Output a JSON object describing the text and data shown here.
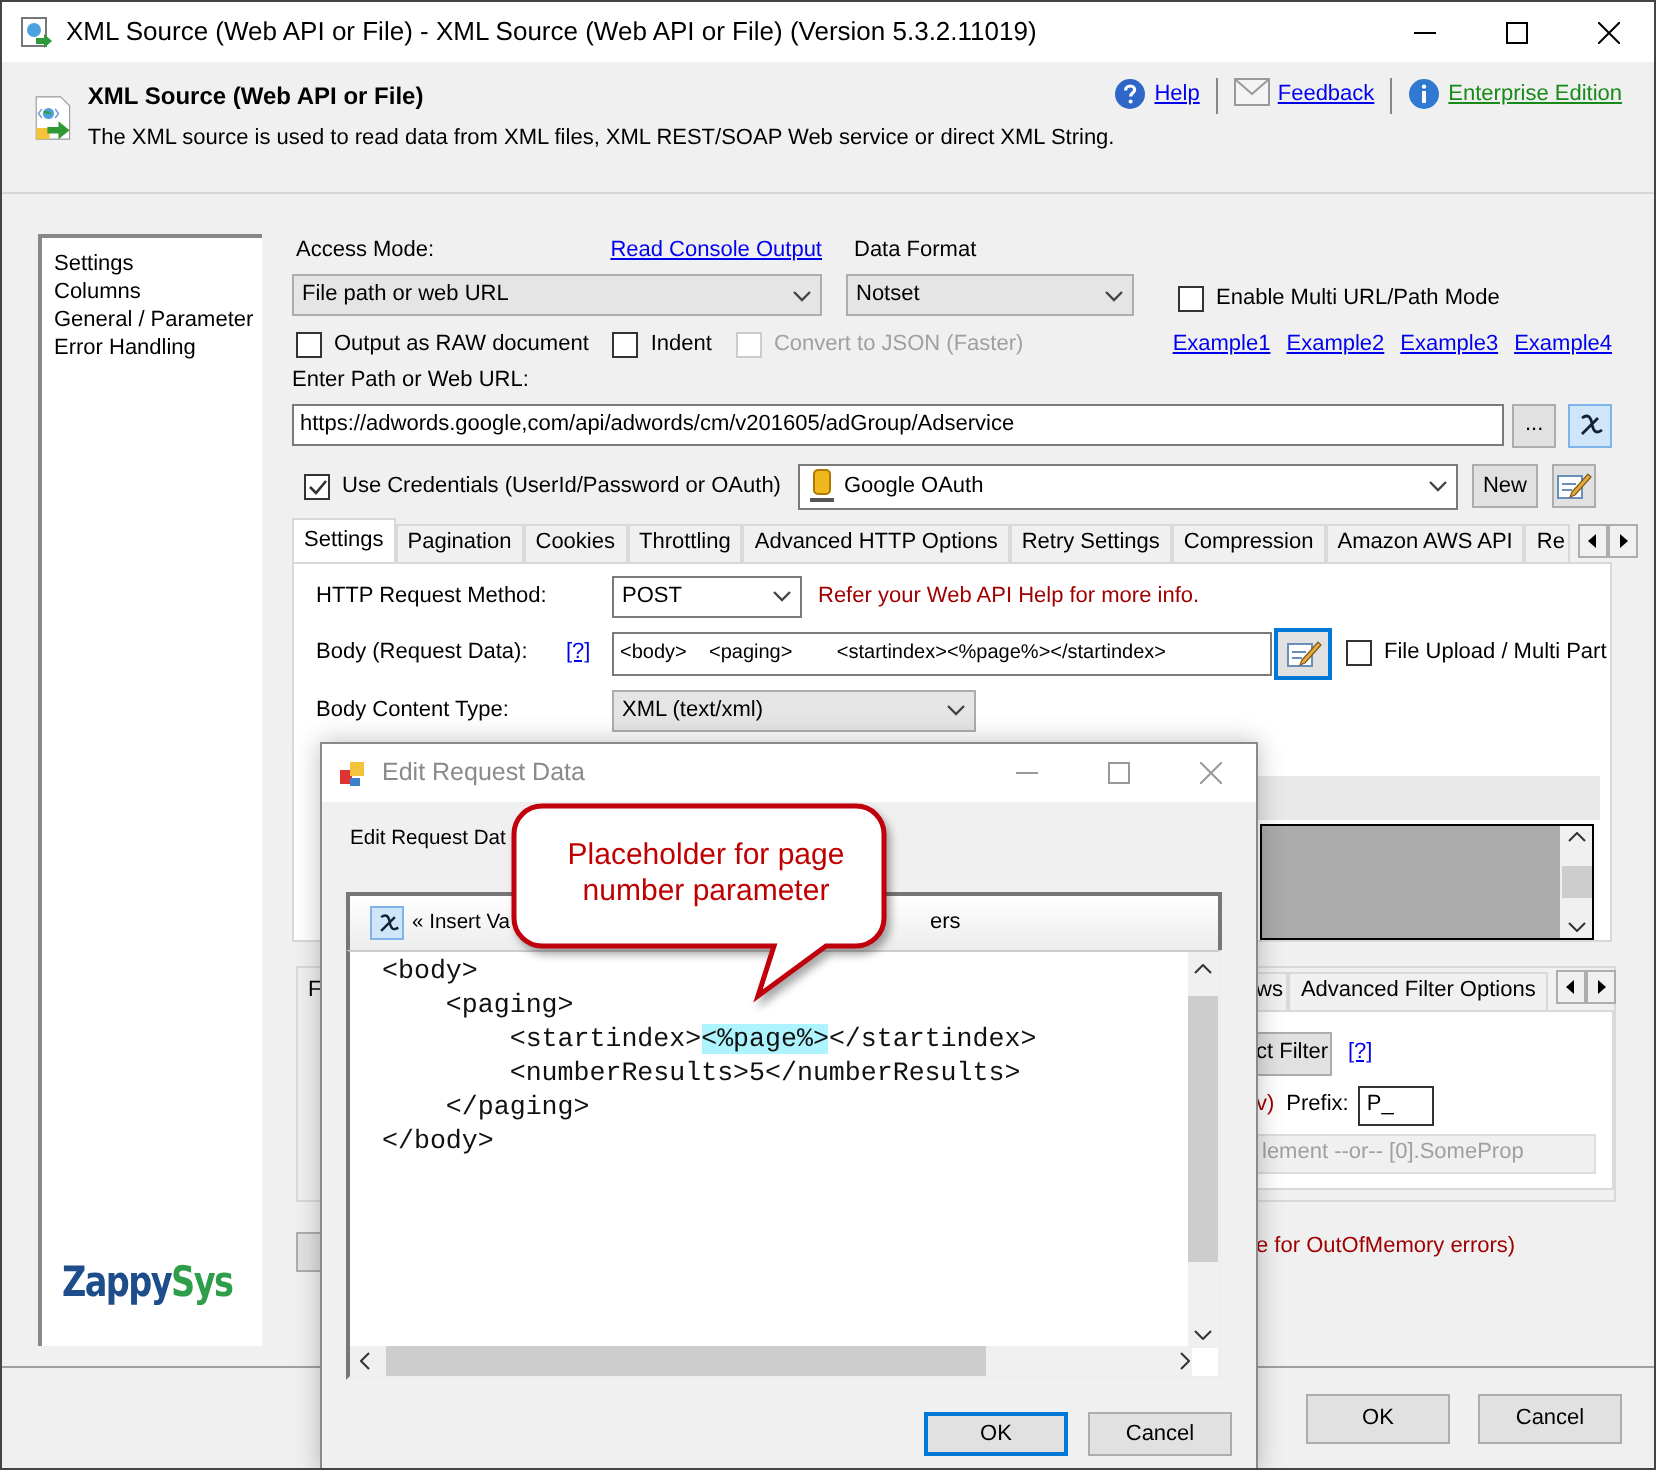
{
  "window": {
    "title": "XML Source (Web API or File) - XML Source (Web API or File) (Version 5.3.2.11019)"
  },
  "header": {
    "title": "XML Source (Web API or File)",
    "description": "The XML source is used to read data from XML files, XML REST/SOAP Web service or direct XML String.",
    "links": [
      {
        "label": "Help",
        "kind": "help"
      },
      {
        "label": "Feedback",
        "kind": "feedback"
      },
      {
        "label": "Enterprise Edition",
        "kind": "edition"
      }
    ]
  },
  "sidebar": {
    "items": [
      {
        "label": "Settings"
      },
      {
        "label": "Columns"
      },
      {
        "label": "General / Parameter"
      },
      {
        "label": "Error Handling"
      }
    ],
    "logo": {
      "first": "Zappy",
      "second": "Sys"
    }
  },
  "access_mode": {
    "label": "Access Mode:",
    "value": "File path or web URL",
    "console_link": "Read Console Output"
  },
  "data_format": {
    "label": "Data Format",
    "value": "Notset"
  },
  "multi_url": {
    "label": "Enable Multi URL/Path Mode",
    "checked": false
  },
  "options": [
    {
      "label": "Output as RAW document",
      "checked": false,
      "disabled": false
    },
    {
      "label": "Indent",
      "checked": false,
      "disabled": false
    },
    {
      "label": "Convert to JSON (Faster)",
      "checked": false,
      "disabled": true
    }
  ],
  "examples": [
    "Example1",
    "Example2",
    "Example3",
    "Example4"
  ],
  "url": {
    "label": "Enter Path or Web URL:",
    "value": "https://adwords.google,com/api/adwords/cm/v201605/adGroup/Adservice",
    "browse": "..."
  },
  "credentials": {
    "label": "Use Credentials (UserId/Password or OAuth)",
    "checked": true,
    "connection": "Google OAuth",
    "new_button": "New"
  },
  "tabs": [
    {
      "label": "Settings",
      "selected": true
    },
    {
      "label": "Pagination",
      "selected": false
    },
    {
      "label": "Cookies",
      "selected": false
    },
    {
      "label": "Throttling",
      "selected": false
    },
    {
      "label": "Advanced HTTP Options",
      "selected": false
    },
    {
      "label": "Retry Settings",
      "selected": false
    },
    {
      "label": "Compression",
      "selected": false
    },
    {
      "label": "Amazon AWS API",
      "selected": false
    },
    {
      "label": "Re",
      "selected": false
    }
  ],
  "settings": {
    "method_label": "HTTP Request Method:",
    "method": "POST",
    "hint": "Refer your Web API Help for more info.",
    "body_label": "Body (Request Data):",
    "body_help": "[?]",
    "body_value": "<body>    <paging>        <startindex><%page%></startindex>",
    "file_upload": {
      "label": "File Upload / Multi Part",
      "checked": false
    },
    "content_type_label": "Body Content Type:",
    "content_type": "XML (text/xml)"
  },
  "lower": {
    "section_fragment": "F",
    "tabs": [
      {
        "label": "ws",
        "selected": false
      },
      {
        "label": "Advanced Filter Options",
        "selected": false
      }
    ],
    "filter_button": "ct Filter",
    "filter_help": "[?]",
    "prefix_fragment": "v)",
    "prefix_label": "Prefix:",
    "prefix_value": "P_",
    "path_placeholder": "lement --or-- [0].SomeProp",
    "memory_note": "e for OutOfMemory errors)"
  },
  "footer": {
    "buttons": [
      {
        "label": "OK",
        "focused": false
      },
      {
        "label": "Cancel",
        "focused": false
      }
    ]
  },
  "dialog": {
    "title": "Edit Request Data",
    "label": "Edit Request Dat",
    "toolbar_left": "« Insert Va",
    "toolbar_right": "ers",
    "lines": [
      {
        "parts": [
          {
            "text": "<body>",
            "highlighted": false
          }
        ]
      },
      {
        "parts": [
          {
            "text": "    <paging>",
            "highlighted": false
          }
        ]
      },
      {
        "parts": [
          {
            "text": "        <startindex>",
            "highlighted": false
          },
          {
            "text": "<%page%>",
            "highlighted": true
          },
          {
            "text": "</startindex>",
            "highlighted": false
          }
        ]
      },
      {
        "parts": [
          {
            "text": "        <numberResults>5</numberResults>",
            "highlighted": false
          }
        ]
      },
      {
        "parts": [
          {
            "text": "    </paging>",
            "highlighted": false
          }
        ]
      },
      {
        "parts": [
          {
            "text": "</body>",
            "highlighted": false
          }
        ]
      }
    ],
    "buttons": [
      {
        "label": "OK",
        "focused": true
      },
      {
        "label": "Cancel",
        "focused": false
      }
    ]
  },
  "callout": {
    "text": "Placeholder for page number parameter"
  }
}
